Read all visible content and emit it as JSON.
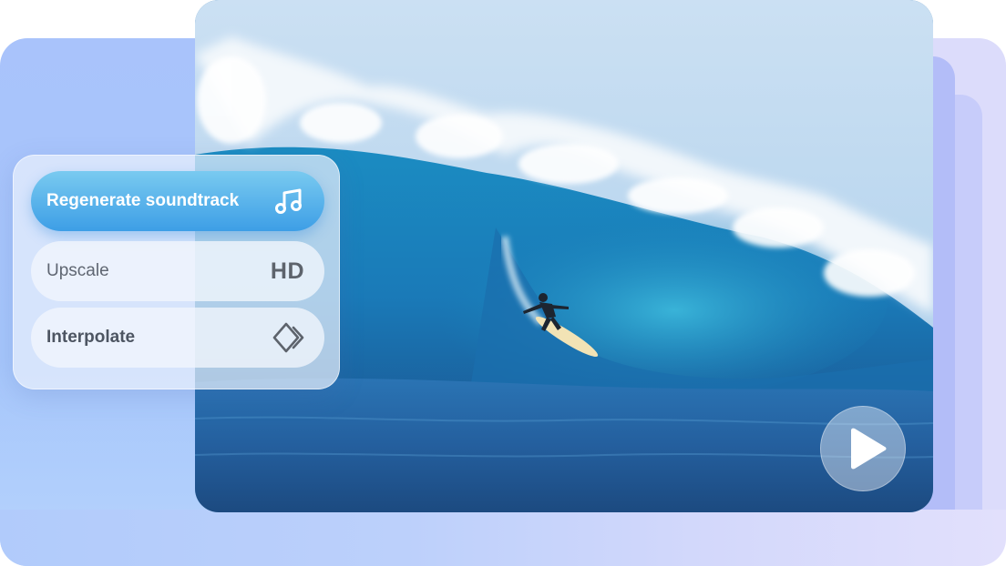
{
  "options": [
    {
      "label": "Regenerate soundtrack",
      "icon": "music-note-icon",
      "active": true
    },
    {
      "label": "Upscale",
      "icon": "hd-icon",
      "badge": "HD",
      "active": false
    },
    {
      "label": "Interpolate",
      "icon": "interpolate-icon",
      "active": false
    }
  ],
  "player": {
    "play_icon": "play-icon"
  },
  "colors": {
    "active_option": "#3d9ee6",
    "panel": "#e9f0fc",
    "background_card": "#a9c3fb",
    "stack_card": "#b3bdf8"
  }
}
